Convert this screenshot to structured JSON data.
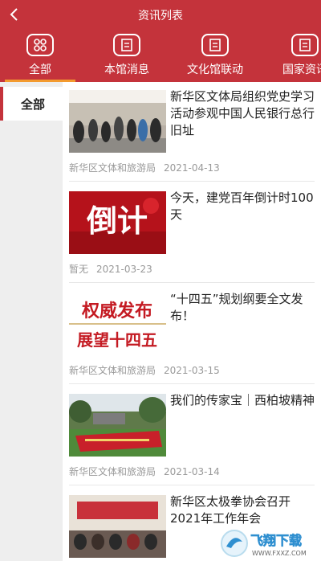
{
  "header": {
    "title": "资讯列表"
  },
  "tabs": [
    {
      "label": "全部",
      "icon": "grid-icon"
    },
    {
      "label": "本馆消息",
      "icon": "document-icon"
    },
    {
      "label": "文化馆联动",
      "icon": "document-icon"
    },
    {
      "label": "国家资讯",
      "icon": "document-icon"
    }
  ],
  "sidebar": {
    "items": [
      {
        "label": "全部"
      }
    ]
  },
  "articles": [
    {
      "title": "新华区文体局组织党史学习活动参观中国人民银行总行旧址",
      "source": "新华区文体和旅游局",
      "date": "2021-04-13"
    },
    {
      "title": "今天，建党百年倒计时100天",
      "source": "暂无",
      "date": "2021-03-23",
      "thumb_text": "倒计"
    },
    {
      "title": "“十四五”规划纲要全文发布！",
      "source": "新华区文体和旅游局",
      "date": "2021-03-15",
      "thumb_text_top": "权威发布",
      "thumb_text_bottom": "展望十四五"
    },
    {
      "title": "我们的传家宝｜西柏坡精神",
      "source": "新华区文体和旅游局",
      "date": "2021-03-14"
    },
    {
      "title": "新华区太极拳协会召开2021年工作年会",
      "source": "",
      "date": ""
    }
  ],
  "watermark": {
    "text": "飞翔下载",
    "url_text": "WWW.FXXZ.COM"
  },
  "colors": {
    "brand": "#c4333b",
    "tab_underline": "#f39a2e"
  }
}
